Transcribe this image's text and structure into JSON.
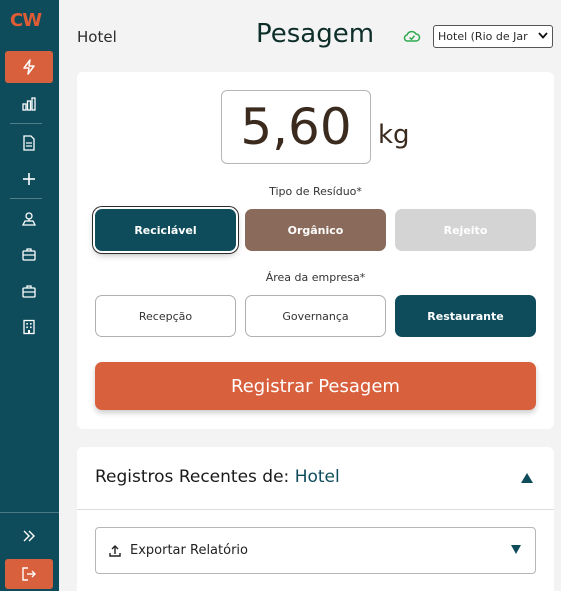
{
  "brand": {
    "logo_text": "CW",
    "accent": "#d9603c",
    "primary": "#0e4c5c"
  },
  "sidebar": {
    "items": [
      {
        "name": "lightning-icon",
        "active": true
      },
      {
        "name": "bar-chart-icon",
        "active": false
      },
      {
        "name": "document-icon",
        "active": false
      },
      {
        "name": "plus-icon",
        "active": false
      },
      {
        "name": "scale-icon",
        "active": false
      },
      {
        "name": "briefcase-icon",
        "active": false
      },
      {
        "name": "briefcase-icon",
        "active": false
      },
      {
        "name": "building-icon",
        "active": false
      }
    ],
    "expand_icon": "double-chevron-right-icon",
    "logout_icon": "logout-icon"
  },
  "header": {
    "hotel_label": "Hotel",
    "title": "Pesagem",
    "sync_icon": "cloud-check-icon",
    "hotel_select_value": "Hotel (Rio de Jar"
  },
  "weighing": {
    "value": "5,60",
    "unit": "kg",
    "waste_type_label": "Tipo de Resíduo*",
    "waste_types": [
      "Reciclável",
      "Orgânico",
      "Rejeito"
    ],
    "waste_type_selected": "Reciclável",
    "area_label": "Área da empresa*",
    "areas": [
      "Recepção",
      "Governança",
      "Restaurante"
    ],
    "area_selected": "Restaurante",
    "register_label": "Registrar Pesagem"
  },
  "records": {
    "title_prefix": "Registros Recentes de:",
    "title_hotel": "Hotel",
    "export_label": "Exportar Relatório"
  }
}
